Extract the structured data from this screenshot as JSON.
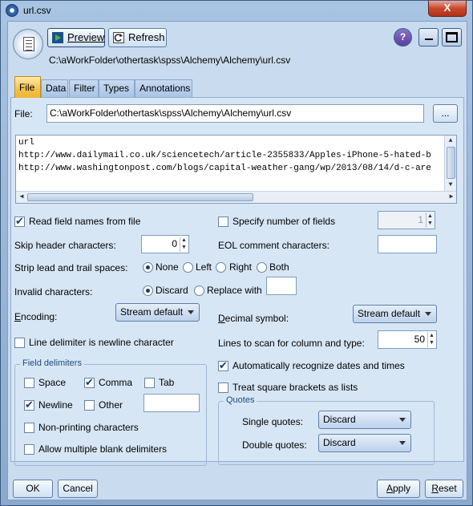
{
  "window": {
    "title": "url.csv",
    "close_label": "X"
  },
  "toolbar": {
    "preview_label": "Preview",
    "refresh_label": "Refresh",
    "path": "C:\\aWorkFolder\\othertask\\spss\\Alchemy\\Alchemy\\url.csv",
    "help_label": "?"
  },
  "tabs": [
    {
      "label": "File"
    },
    {
      "label": "Data"
    },
    {
      "label": "Filter"
    },
    {
      "label": "Types"
    },
    {
      "label": "Annotations"
    }
  ],
  "file": {
    "label": "File:",
    "value": "C:\\aWorkFolder\\othertask\\spss\\Alchemy\\Alchemy\\url.csv",
    "browse_label": "..."
  },
  "preview": {
    "lines": [
      "url",
      "http://www.dailymail.co.uk/sciencetech/article-2355833/Apples-iPhone-5-hated-b",
      "http://www.washingtonpost.com/blogs/capital-weather-gang/wp/2013/08/14/d-c-are"
    ]
  },
  "options": {
    "read_field_names": {
      "label": "Read field names from file",
      "checked": true
    },
    "specify_fields": {
      "label": "Specify number of fields",
      "checked": false,
      "value": "1"
    },
    "skip_header": {
      "label": "Skip header characters:",
      "value": "0"
    },
    "eol_comment": {
      "label": "EOL comment characters:",
      "value": ""
    },
    "strip": {
      "label": "Strip lead and trail spaces:",
      "options": [
        "None",
        "Left",
        "Right",
        "Both"
      ],
      "selected": "None"
    },
    "invalid": {
      "label": "Invalid characters:",
      "options": [
        "Discard",
        "Replace with"
      ],
      "selected": "Discard",
      "replace_value": ""
    },
    "encoding": {
      "label": "Encoding:",
      "value": "Stream default"
    },
    "decimal": {
      "label": "Decimal symbol:",
      "value": "Stream default"
    },
    "line_delim": {
      "label": "Line delimiter is newline character",
      "checked": false
    },
    "lines_scan": {
      "label": "Lines to scan for column and type:",
      "value": "50"
    },
    "auto_dates": {
      "label": "Automatically recognize dates and times",
      "checked": true
    },
    "square_brackets": {
      "label": "Treat square brackets as lists",
      "checked": false
    }
  },
  "field_delimiters": {
    "title": "Field delimiters",
    "space": {
      "label": "Space",
      "checked": false
    },
    "comma": {
      "label": "Comma",
      "checked": true
    },
    "tab": {
      "label": "Tab",
      "checked": false
    },
    "newline": {
      "label": "Newline",
      "checked": true
    },
    "other": {
      "label": "Other",
      "checked": false,
      "value": ""
    },
    "nonprinting": {
      "label": "Non-printing characters",
      "checked": false
    },
    "multiple_blank": {
      "label": "Allow multiple blank delimiters",
      "checked": false
    }
  },
  "quotes": {
    "title": "Quotes",
    "single": {
      "label": "Single quotes:",
      "value": "Discard"
    },
    "double": {
      "label": "Double quotes:",
      "value": "Discard"
    }
  },
  "footer": {
    "ok": "OK",
    "cancel": "Cancel",
    "apply": "Apply",
    "reset": "Reset"
  }
}
